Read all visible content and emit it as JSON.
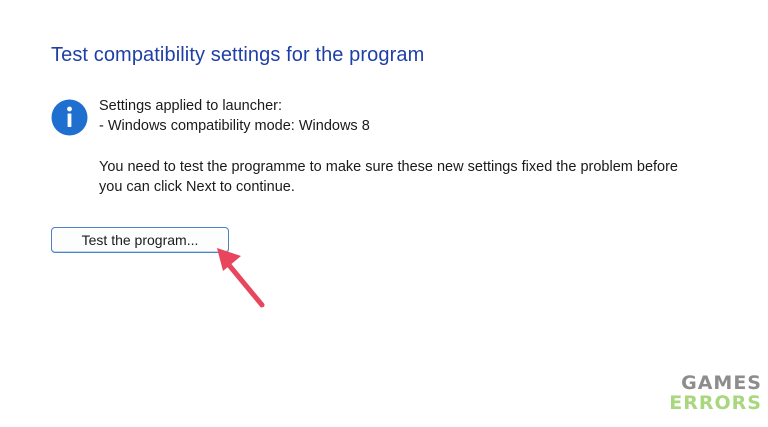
{
  "dialog": {
    "title": "Test compatibility settings for the program",
    "applied_heading": "Settings applied to launcher:",
    "applied_detail": "- Windows compatibility mode: Windows 8",
    "note_line1": "You need to test the programme to make sure these new settings fixed the problem before",
    "note_line2": "you can click Next to continue.",
    "test_button_label": "Test the program...",
    "info_icon": "info-icon",
    "arrow_icon": "arrow-pointer-icon"
  },
  "watermark": {
    "line1": "GAMES",
    "line2": "ERRORS"
  },
  "colors": {
    "title": "#1f3fa8",
    "info_icon_bg": "#1f6fd1",
    "button_border": "#4a82c9",
    "arrow": "#e8465d",
    "watermark_top": "#8d8d8d",
    "watermark_bottom": "#a8d77e"
  }
}
